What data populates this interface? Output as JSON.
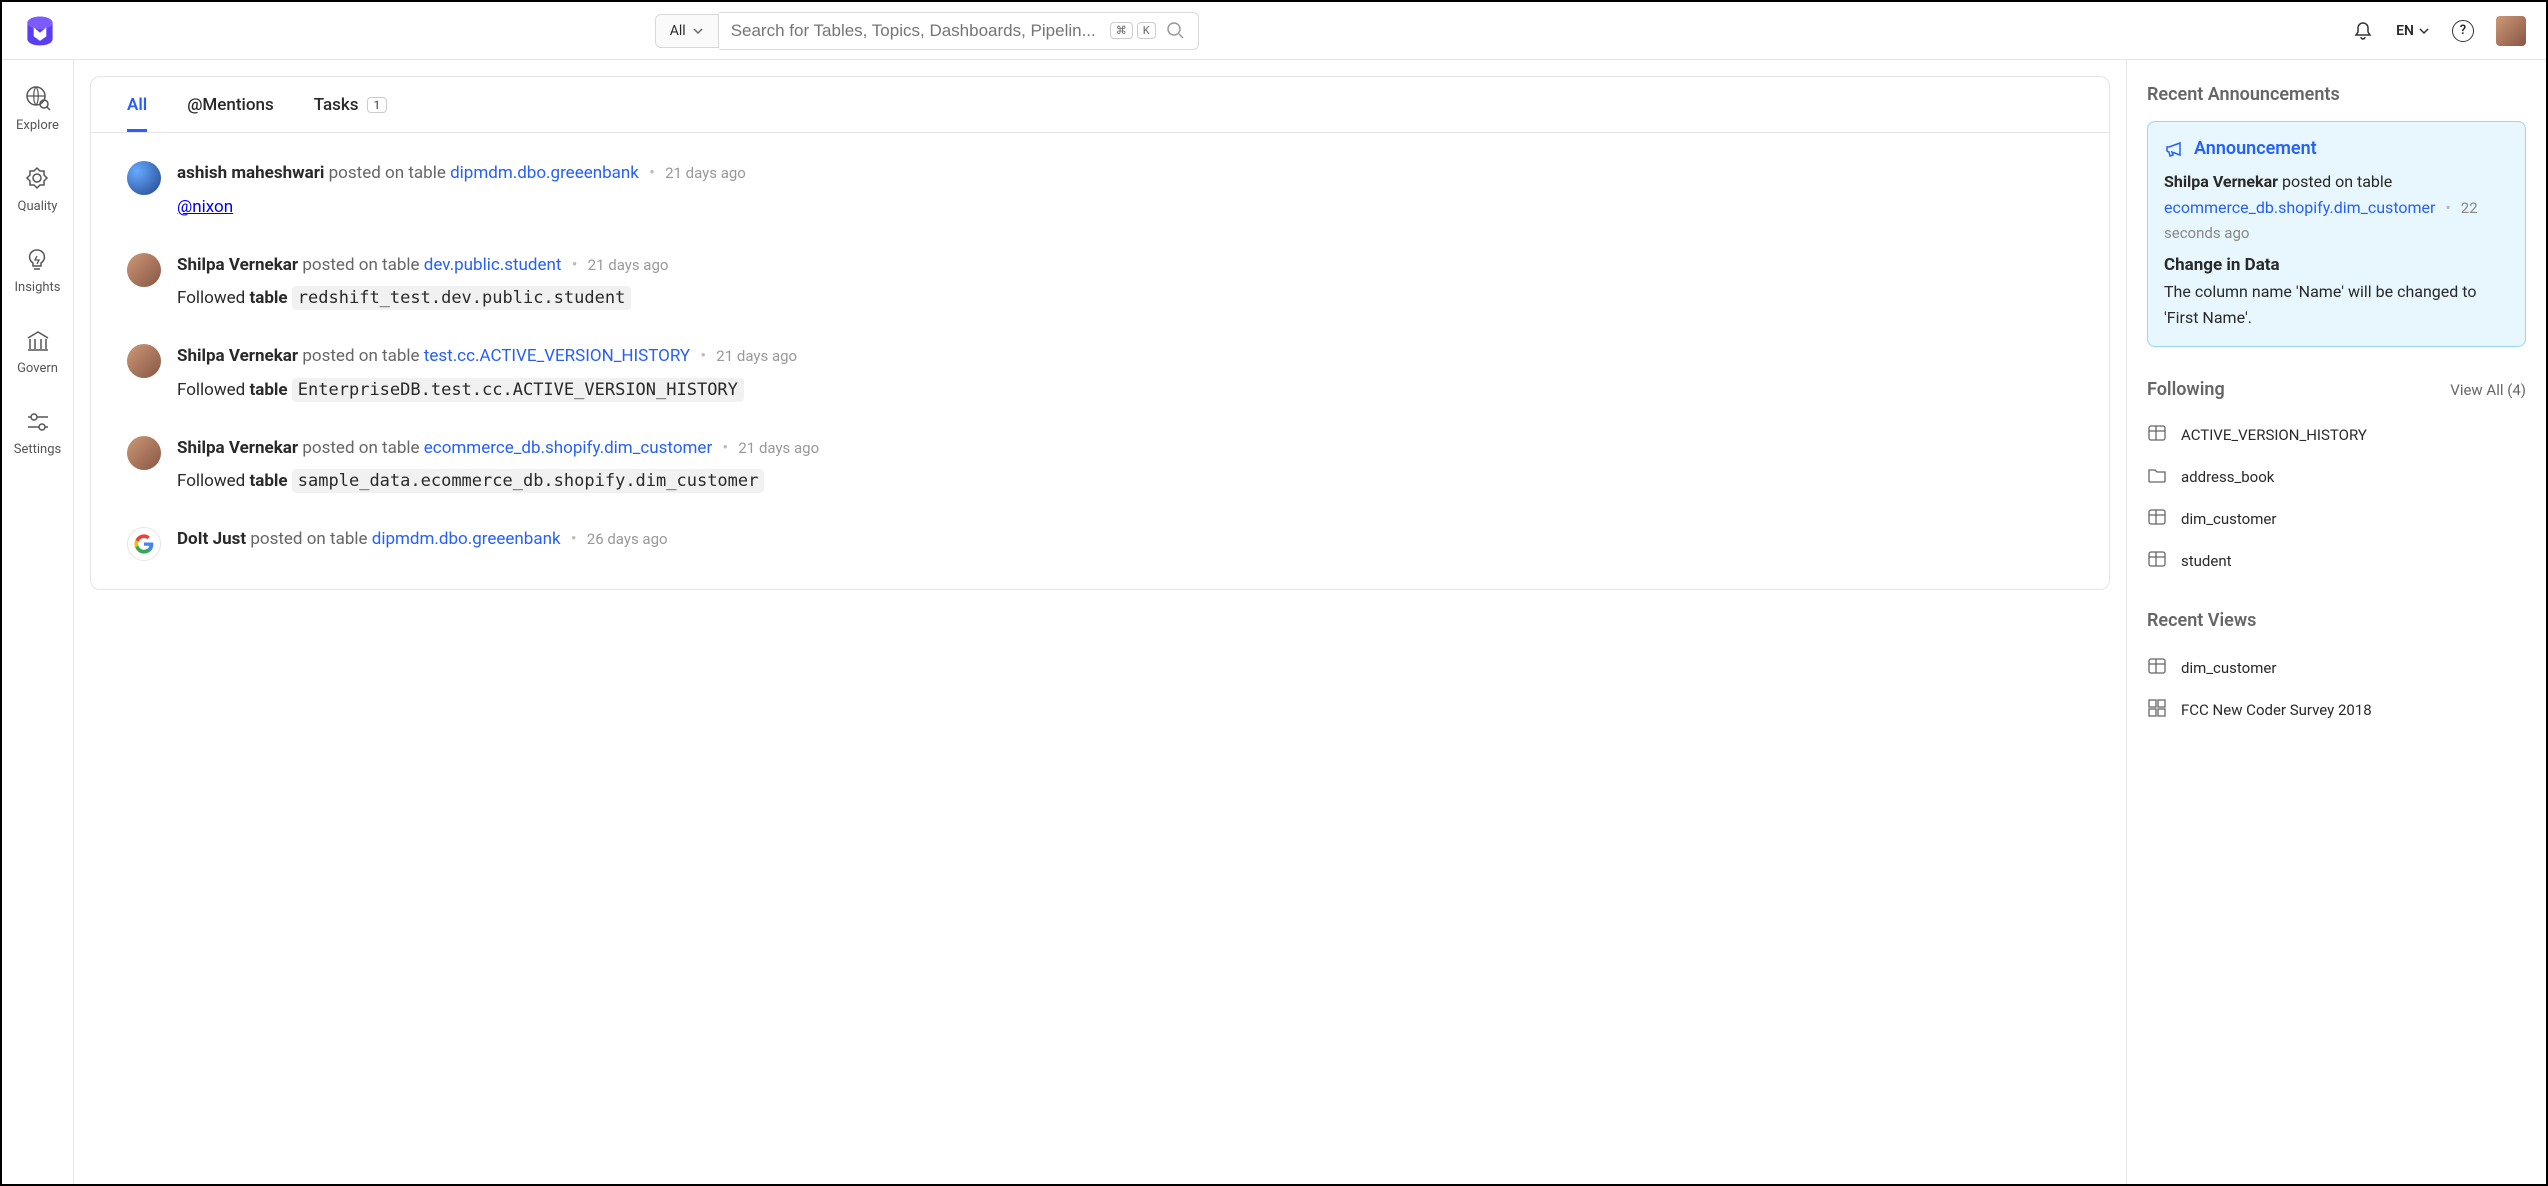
{
  "header": {
    "search_filter": "All",
    "search_placeholder": "Search for Tables, Topics, Dashboards, Pipelin...",
    "shortcut1": "⌘",
    "shortcut2": "K",
    "lang": "EN"
  },
  "sidebar": {
    "items": [
      {
        "label": "Explore"
      },
      {
        "label": "Quality"
      },
      {
        "label": "Insights"
      },
      {
        "label": "Govern"
      },
      {
        "label": "Settings"
      }
    ]
  },
  "tabs": {
    "all": "All",
    "mentions": "@Mentions",
    "tasks": "Tasks",
    "tasks_count": "1"
  },
  "feed": [
    {
      "avatar": "av1",
      "user": "ashish maheshwari",
      "action": "posted on table",
      "link": "dipmdm.dbo.greeenbank",
      "time": "21 days ago",
      "content_type": "mention",
      "mention": "@nixon"
    },
    {
      "avatar": "av2",
      "user": "Shilpa Vernekar",
      "action": "posted on table",
      "link": "dev.public.student",
      "time": "21 days ago",
      "content_type": "followed",
      "code": "redshift_test.dev.public.student"
    },
    {
      "avatar": "av2",
      "user": "Shilpa Vernekar",
      "action": "posted on table",
      "link": "test.cc.ACTIVE_VERSION_HISTORY",
      "time": "21 days ago",
      "content_type": "followed",
      "code": "EnterpriseDB.test.cc.ACTIVE_VERSION_HISTORY"
    },
    {
      "avatar": "av2",
      "user": "Shilpa Vernekar",
      "action": "posted on table",
      "link": "ecommerce_db.shopify.dim_customer",
      "time": "21 days ago",
      "content_type": "followed",
      "code": "sample_data.ecommerce_db.shopify.dim_customer"
    },
    {
      "avatar": "av-google",
      "user": "DoIt Just",
      "action": "posted on table",
      "link": "dipmdm.dbo.greeenbank",
      "time": "26 days ago",
      "content_type": "none"
    }
  ],
  "right": {
    "announcements_title": "Recent Announcements",
    "announce_label": "Announcement",
    "announce_user": "Shilpa Vernekar",
    "announce_action": "posted on table",
    "announce_link": "ecommerce_db.shopify.dim_customer",
    "announce_time": "22 seconds ago",
    "announce_heading": "Change in Data",
    "announce_text": "The column name 'Name' will be changed to 'First Name'.",
    "following_title": "Following",
    "following_viewall": "View All (4)",
    "following": [
      {
        "icon": "table",
        "name": "ACTIVE_VERSION_HISTORY"
      },
      {
        "icon": "folder",
        "name": "address_book"
      },
      {
        "icon": "table",
        "name": "dim_customer"
      },
      {
        "icon": "table",
        "name": "student"
      }
    ],
    "recent_views_title": "Recent Views",
    "recent_views": [
      {
        "icon": "table",
        "name": "dim_customer"
      },
      {
        "icon": "dashboard",
        "name": "FCC New Coder Survey 2018"
      }
    ]
  },
  "misc": {
    "followed_prefix": "Followed",
    "followed_entity": "table",
    "sep": "•"
  }
}
